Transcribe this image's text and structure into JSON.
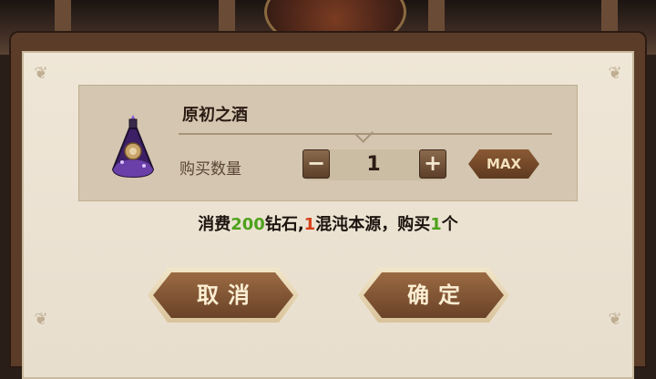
{
  "item": {
    "name": "原初之酒",
    "qty_label": "购买数量",
    "quantity": "1",
    "minus_symbol": "−",
    "plus_symbol": "+",
    "max_label": "MAX",
    "icon": "purple-potion-icon"
  },
  "cost": {
    "part1": "消费",
    "diamonds": "200",
    "part2": "钻石,",
    "chaos": "1",
    "part3": "混沌本源，购买",
    "buy_count": "1",
    "part4": "个"
  },
  "buttons": {
    "cancel_label": "取消",
    "confirm_label": "确定"
  },
  "colors": {
    "highlight_green": "#4ea21c",
    "highlight_red": "#d6401a",
    "panel_bg": "#efe6d7"
  }
}
